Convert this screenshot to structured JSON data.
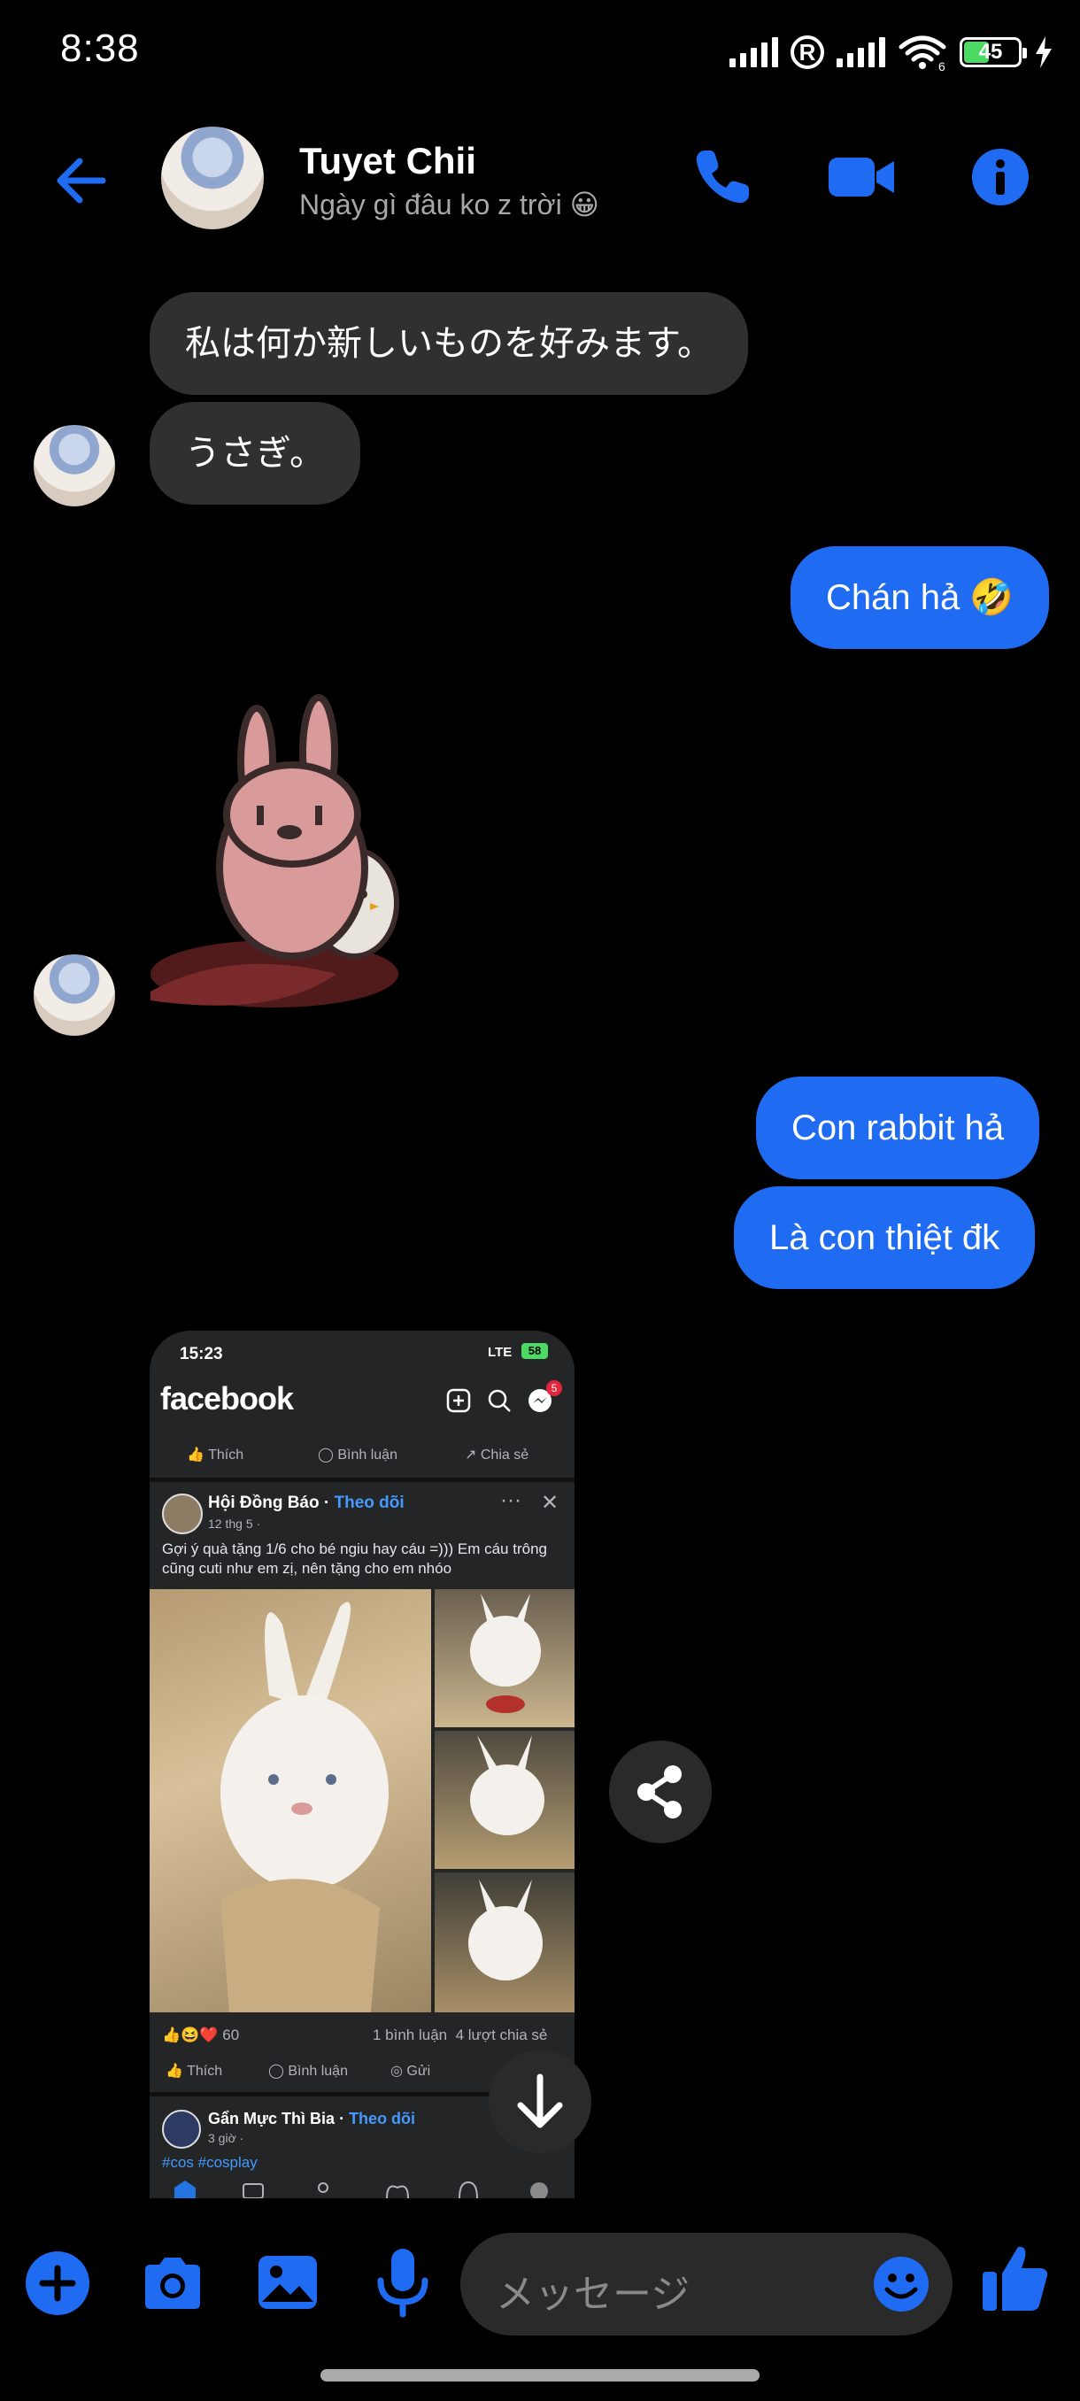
{
  "status_bar": {
    "time": "8:38",
    "battery": "45",
    "wifi_badge": "6"
  },
  "header": {
    "name": "Tuyet Chii",
    "status": "Ngày gì đâu ko z trời 😀"
  },
  "messages": [
    {
      "from": "them",
      "text": "私は何か新しいものを好みます。"
    },
    {
      "from": "them",
      "text": "うさぎ。"
    },
    {
      "from": "me",
      "text": "Chán hả 🤣"
    },
    {
      "from": "them",
      "type": "sticker",
      "sticker": "pink-rabbit-sticker"
    },
    {
      "from": "me",
      "text": "Con rabbit hả"
    },
    {
      "from": "me",
      "text": "Là con thiệt đk"
    },
    {
      "from": "them",
      "type": "image",
      "image": "facebook-post-screenshot"
    }
  ],
  "shared_screenshot": {
    "time": "15:23",
    "network": "LTE",
    "battery": "58",
    "logo": "facebook",
    "messenger_badge": "5",
    "top_actions": [
      "Thích",
      "Bình luận",
      "Chia sẻ"
    ],
    "post": {
      "page": "Hội Đồng Báo",
      "follow": "Theo dõi",
      "date": "12 thg 5 ·",
      "text": "Gợi ý quà tặng 1/6 cho bé ngiu hay cáu =))) Em cáu trông cũng cuti như em zị, nên tặng cho em nhóo",
      "reactions": "60",
      "comments": "1 bình luận",
      "shares": "4 lượt chia sẻ",
      "actions": [
        "Thích",
        "Bình luận",
        "Gửi"
      ]
    },
    "next_post": {
      "page": "Gẩn Mực Thì Bia",
      "follow": "Theo dõi",
      "date": "3 giờ ·",
      "tags": "#cos #cosplay"
    }
  },
  "composer": {
    "placeholder": "メッセージ"
  },
  "colors": {
    "accent": "#1f6bf2",
    "incoming_bubble": "#303030",
    "background": "#000000"
  }
}
